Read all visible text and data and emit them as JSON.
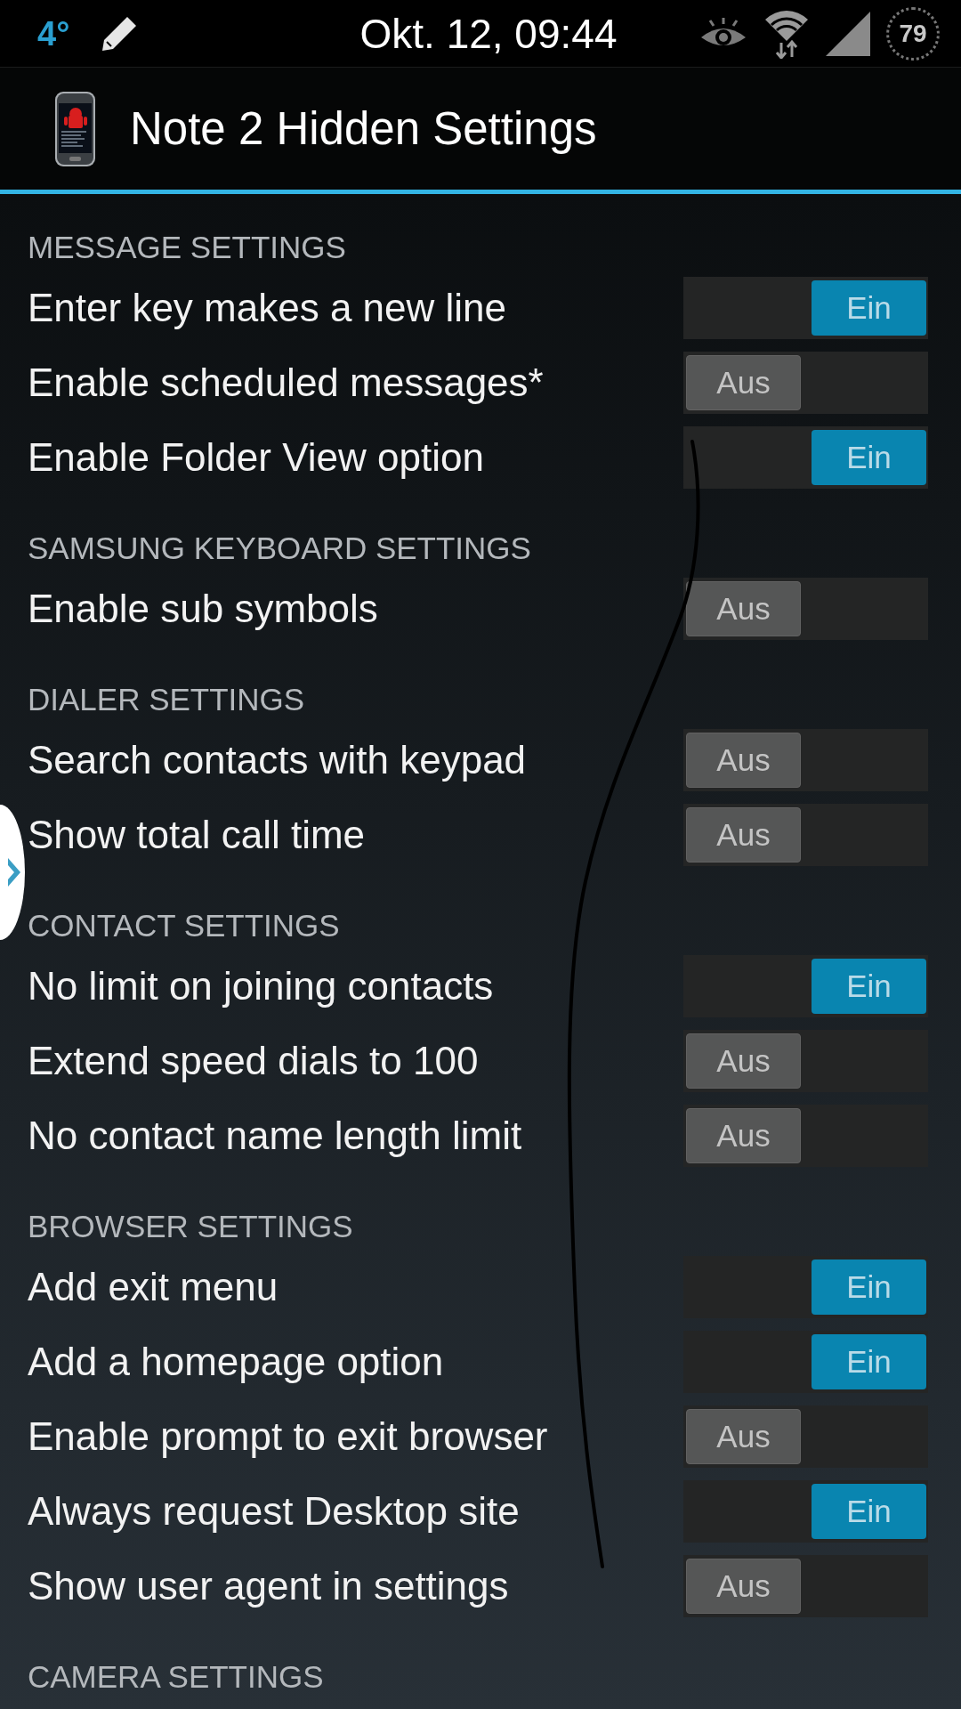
{
  "status_bar": {
    "temperature": "4°",
    "time": "Okt. 12, 09:44",
    "battery": "79"
  },
  "app_bar": {
    "title": "Note 2 Hidden Settings"
  },
  "sections": [
    {
      "title": "MESSAGE SETTINGS",
      "items": [
        {
          "label": "Enter key makes a new line",
          "on": true,
          "switch_text": "Ein"
        },
        {
          "label": "Enable scheduled messages*",
          "on": false,
          "switch_text": "Aus"
        },
        {
          "label": "Enable Folder View option",
          "on": true,
          "switch_text": "Ein"
        }
      ]
    },
    {
      "title": "SAMSUNG KEYBOARD SETTINGS",
      "items": [
        {
          "label": "Enable sub symbols",
          "on": false,
          "switch_text": "Aus"
        }
      ]
    },
    {
      "title": "DIALER SETTINGS",
      "items": [
        {
          "label": "Search contacts with keypad",
          "on": false,
          "switch_text": "Aus"
        },
        {
          "label": "Show total call time",
          "on": false,
          "switch_text": "Aus"
        }
      ]
    },
    {
      "title": "CONTACT SETTINGS",
      "items": [
        {
          "label": "No limit on joining contacts",
          "on": true,
          "switch_text": "Ein"
        },
        {
          "label": "Extend speed dials to 100",
          "on": false,
          "switch_text": "Aus"
        },
        {
          "label": "No contact name length limit",
          "on": false,
          "switch_text": "Aus"
        }
      ]
    },
    {
      "title": "BROWSER SETTINGS",
      "items": [
        {
          "label": "Add exit menu",
          "on": true,
          "switch_text": "Ein"
        },
        {
          "label": "Add a homepage option",
          "on": true,
          "switch_text": "Ein"
        },
        {
          "label": "Enable prompt to exit browser",
          "on": false,
          "switch_text": "Aus"
        },
        {
          "label": "Always request Desktop site",
          "on": true,
          "switch_text": "Ein"
        },
        {
          "label": "Show user agent in settings",
          "on": false,
          "switch_text": "Aus"
        }
      ]
    },
    {
      "title": "CAMERA SETTINGS"
    }
  ]
}
